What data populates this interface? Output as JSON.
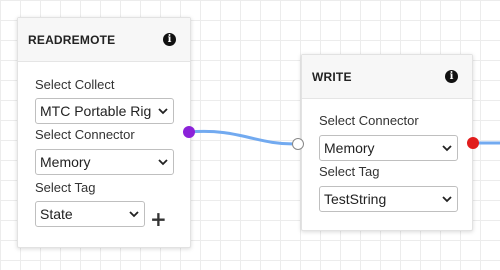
{
  "colors": {
    "wire": "#72aaf0",
    "output_port_read": "#8b22d9",
    "input_port_write": "#ffffff",
    "output_port_write": "#e11d1d"
  },
  "icons": {
    "info": "info-icon",
    "add": "plus-icon",
    "dropdown": "chevron-down-icon"
  },
  "nodes": {
    "readremote": {
      "title": "READREMOTE",
      "info_glyph": "i",
      "fields": {
        "collect": {
          "label": "Select Collect",
          "value": "MTC Portable Rig"
        },
        "connector": {
          "label": "Select Connector",
          "value": "Memory"
        },
        "tag": {
          "label": "Select Tag",
          "value": "State"
        }
      },
      "add_glyph": "+"
    },
    "write": {
      "title": "WRITE",
      "info_glyph": "i",
      "fields": {
        "connector": {
          "label": "Select Connector",
          "value": "Memory"
        },
        "tag": {
          "label": "Select Tag",
          "value": "TestString"
        }
      }
    }
  }
}
